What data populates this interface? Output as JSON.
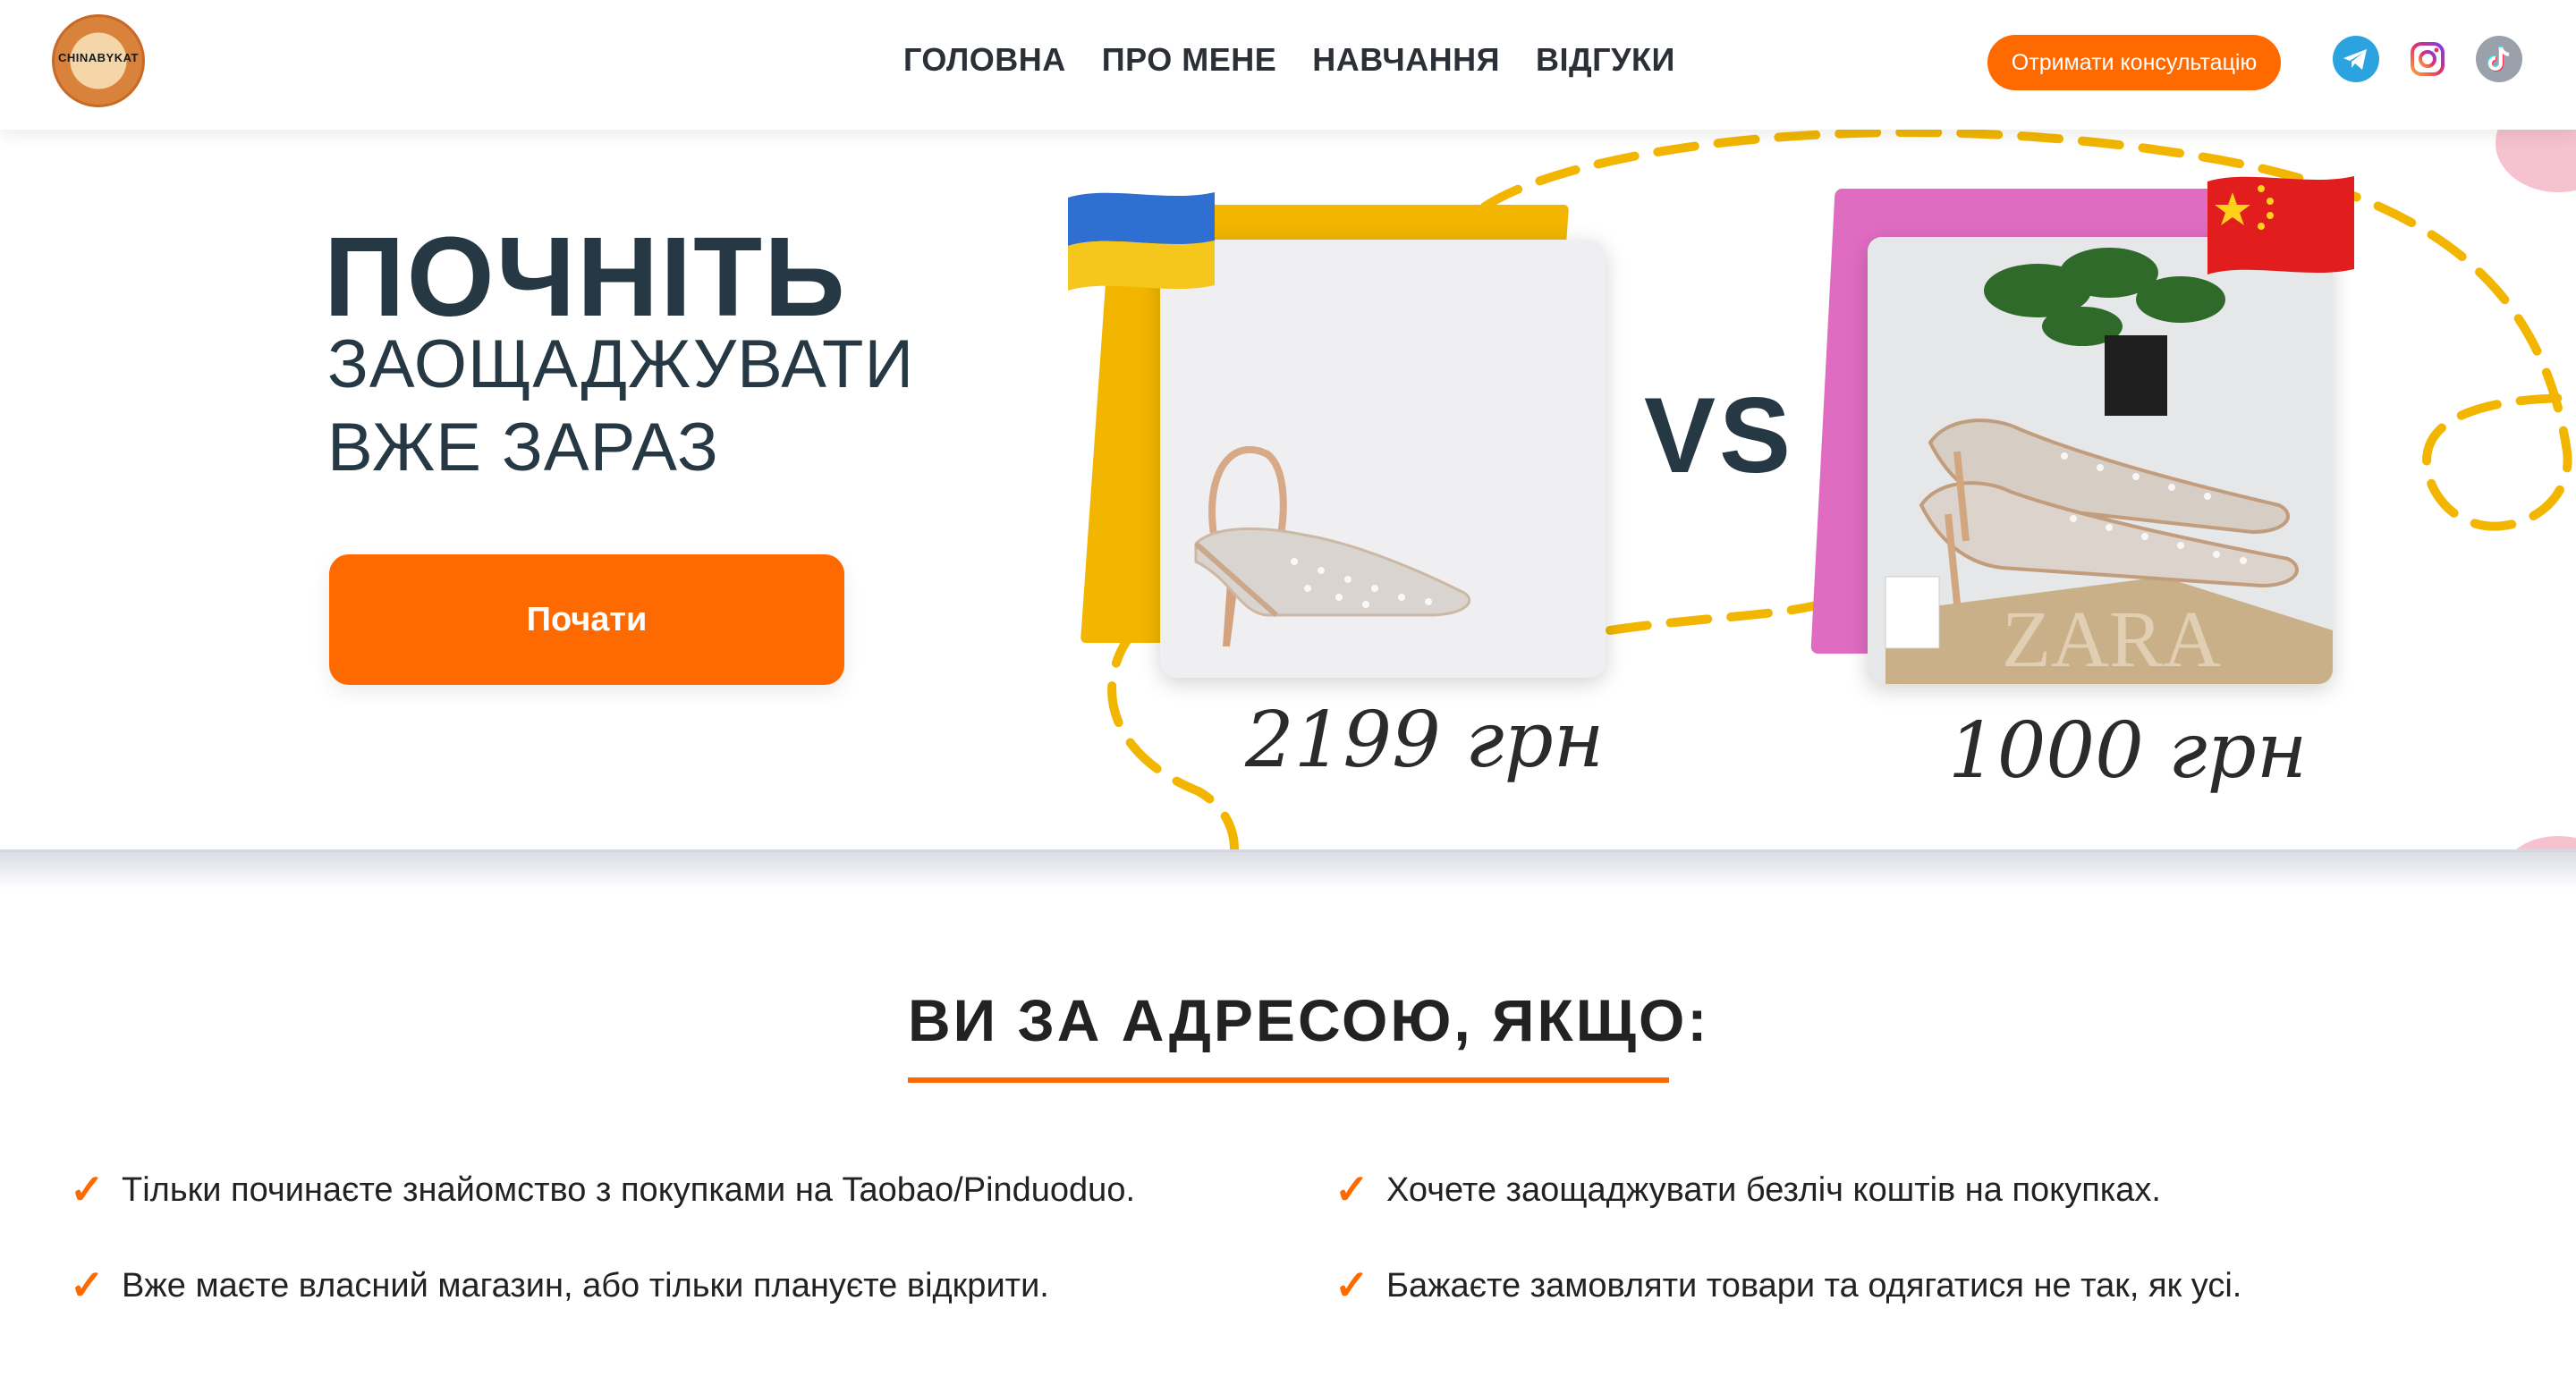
{
  "header": {
    "logo_text": "CHINABYKAT",
    "nav": [
      {
        "label": "ГОЛОВНА"
      },
      {
        "label": "ПРО МЕНЕ"
      },
      {
        "label": "НАВЧАННЯ"
      },
      {
        "label": "ВІДГУКИ"
      }
    ],
    "cta_label": "Отримати консультацію",
    "social": [
      "telegram-icon",
      "instagram-icon",
      "tiktok-icon"
    ]
  },
  "hero": {
    "title_line1": "ПОЧНІТЬ",
    "title_line2": "ЗАОЩАДЖУВАТИ",
    "title_line3": "ВЖЕ ЗАРАЗ",
    "start_button": "Почати",
    "vs_text": "VS",
    "price_left": "2199 грн",
    "price_right": "1000 грн",
    "box_text": "ZARA"
  },
  "audience": {
    "title": "ВИ ЗА АДРЕСОЮ, ЯКЩО:",
    "items": [
      "Тільки починаєте знайомство з покупками на Taobao/Pinduoduo.",
      "Хочете заощаджувати безліч коштів на покупках.",
      "Вже маєте власний магазин, або тільки плануєте відкрити.",
      "Бажаєте замовляти товари та одягатися не так, як усі."
    ]
  },
  "colors": {
    "accent": "#ff6a00",
    "heading": "#263843",
    "dash": "#f2b600",
    "pink": "#e06cc2"
  }
}
